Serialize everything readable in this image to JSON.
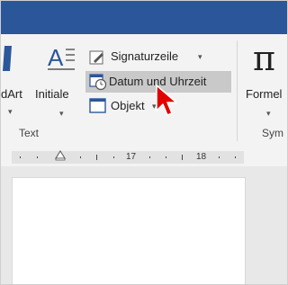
{
  "ribbon": {
    "wordart_label": "dArt",
    "initial_label": "Initiale",
    "signature_label": "Signaturzeile",
    "datetime_label": "Datum und Uhrzeit",
    "object_label": "Objekt",
    "formula_label": "Formel",
    "formula_glyph": "π",
    "group_text_label": "Text",
    "group_symbols_label": "Sym"
  },
  "ruler": {
    "labels": [
      "17",
      "18"
    ]
  },
  "colors": {
    "titlebar": "#2b579a",
    "accent_blue": "#2b579a",
    "highlight": "#c9c9c9",
    "cursor": "#e00000"
  },
  "icons": [
    "wordart-icon",
    "dropcap-icon",
    "signature-icon",
    "datetime-icon",
    "object-icon",
    "formula-icon",
    "indent-marker-icon",
    "mouse-cursor-icon"
  ]
}
